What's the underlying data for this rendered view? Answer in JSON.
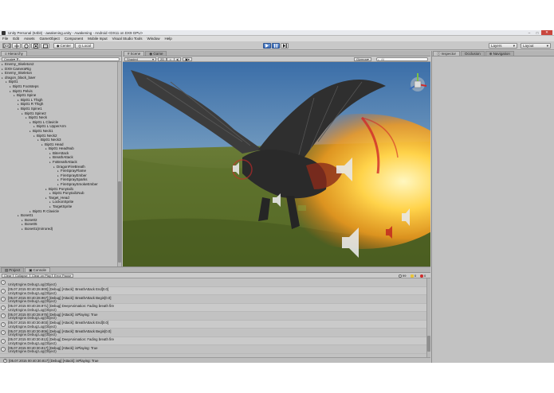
{
  "window": {
    "title": "Unity Personal (64bit) - awakening.unity - Awakening - Android <DX11 on DX9 GPU>",
    "controls": [
      "–",
      "□",
      "✕"
    ]
  },
  "menu": [
    "File",
    "Edit",
    "Assets",
    "GameObject",
    "Component",
    "Mobile Input",
    "Visual Studio Tools",
    "Window",
    "Help"
  ],
  "toolbar": {
    "center_label": "Center",
    "local_label": "Local",
    "layers_label": "Layers",
    "layout_label": "Layout"
  },
  "hierarchy": {
    "tab": "Hierarchy",
    "create_label": "Create",
    "items": [
      {
        "label": "Enemy_Skeleton2",
        "depth": 0
      },
      {
        "label": "DX9 CameraRig",
        "depth": 0
      },
      {
        "label": "Enemy_Skeleton",
        "depth": 0
      },
      {
        "label": "dragon_black_baer",
        "depth": 0
      },
      {
        "label": "Bip01",
        "depth": 1
      },
      {
        "label": "Bip01 Footsteps",
        "depth": 2
      },
      {
        "label": "Bip01 Pelvis",
        "depth": 2
      },
      {
        "label": "Bip01 Spine",
        "depth": 3
      },
      {
        "label": "Bip01 L Thigh",
        "depth": 4
      },
      {
        "label": "Bip01 R Thigh",
        "depth": 4
      },
      {
        "label": "Bip01 Spine1",
        "depth": 4
      },
      {
        "label": "Bip01 Spine2",
        "depth": 5
      },
      {
        "label": "Bip01 Neck",
        "depth": 6
      },
      {
        "label": "Bip01 L Clavicle",
        "depth": 7
      },
      {
        "label": "Bip01 L UpperArm",
        "depth": 8
      },
      {
        "label": "Bip01 Neck1",
        "depth": 7
      },
      {
        "label": "Bip01 Neck2",
        "depth": 8
      },
      {
        "label": "Bip01 Neck3",
        "depth": 9
      },
      {
        "label": "Bip01 Head",
        "depth": 10
      },
      {
        "label": "Bip01 HeadNub",
        "depth": 11
      },
      {
        "label": "BiteAttack",
        "depth": 12
      },
      {
        "label": "BreathAttack",
        "depth": 12
      },
      {
        "label": "FxBreathAttack",
        "depth": 12
      },
      {
        "label": "DragonFireBreath",
        "depth": 13
      },
      {
        "label": "FireSprayFlame",
        "depth": 14
      },
      {
        "label": "FireSprayEmber",
        "depth": 14
      },
      {
        "label": "FireSpraySparks",
        "depth": 14
      },
      {
        "label": "FireSpraySmokeEmber",
        "depth": 14
      },
      {
        "label": "Bip01 Ponytail1",
        "depth": 11
      },
      {
        "label": "Bip01 Ponytail1Nub",
        "depth": 12
      },
      {
        "label": "Target_Head",
        "depth": 11
      },
      {
        "label": "LockonSprite",
        "depth": 12
      },
      {
        "label": "TargetSprite",
        "depth": 12
      },
      {
        "label": "Bip01 R Clavicle",
        "depth": 7
      },
      {
        "label": "Bone01",
        "depth": 4
      },
      {
        "label": "Bone02",
        "depth": 5
      },
      {
        "label": "Bone05",
        "depth": 5
      },
      {
        "label": "Bone01(mirrored)",
        "depth": 5
      }
    ]
  },
  "scene": {
    "tab_scene": "Scene",
    "tab_game": "Game",
    "shading": "Shaded",
    "mode_2d": "2D",
    "gizmos": "Gizmos",
    "search_placeholder": "All"
  },
  "inspector": {
    "tab_inspector": "Inspector",
    "tab_occlusion": "Occlusion",
    "tab_navigation": "Navigation"
  },
  "bottom_tabs": {
    "project": "Project",
    "console": "Console"
  },
  "console": {
    "buttons": [
      "Clear",
      "Collapse",
      "Clear on Play",
      "Error Pause"
    ],
    "counts": {
      "info": "99",
      "warn": "0",
      "error": "0"
    },
    "logs": [
      {
        "line1": "",
        "line2": "UnityEngine.Debug:Log(Object)"
      },
      {
        "line1": "[05.07.2015 00:40:28.900] [Debug] [Attack]: BreathAttack End[0.0]",
        "line2": "UnityEngine.Debug:Log(Object)"
      },
      {
        "line1": "[05.07.2015 00:40:28.967] [Debug] [Attack]: BreathAttack Begin[0.0]",
        "line2": "UnityEngine.Debug:Log(Object)"
      },
      {
        "line1": "[05.07.2015 00:40:28.971] [Debug] DeepAnimation: Fading breath fire",
        "line2": "UnityEngine.Debug:Log(Object)"
      },
      {
        "line1": "[05.07.2015 00:40:28.975] [Debug] [Attack]: isPlaying: True",
        "line2": "UnityEngine.Debug:Log(Object)"
      },
      {
        "line1": "[05.07.2015 00:40:30.803] [Debug] [Attack]: BreathAttack End[0.0]",
        "line2": "UnityEngine.Debug:Log(Object)"
      },
      {
        "line1": "[05.07.2015 00:40:30.806] [Debug] [Attack]: BreathAttack Begin[0.0]",
        "line2": "UnityEngine.Debug:Log(Object)"
      },
      {
        "line1": "[05.07.2015 00:40:30.812] [Debug] DeepAnimation: Fading breath fire",
        "line2": "UnityEngine.Debug:Log(Object)"
      },
      {
        "line1": "[05.07.2015 00:40:30.817] [Debug] [Attack]: isPlaying: True",
        "line2": "UnityEngine.Debug:Log(Object)"
      }
    ]
  },
  "status": {
    "text": "[05.07.2015 00:40:30.817] [Debug] [Attack]: isPlaying: True"
  },
  "colors": {
    "editor_bg": "#c2c2c2",
    "play_blue": "#3b6dbb",
    "fire": "#f5a623",
    "gizmo_red": "#d02a2a"
  },
  "icons": [
    "hand-icon",
    "move-icon",
    "rotate-icon",
    "scale-icon",
    "rect-icon",
    "play-icon",
    "pause-icon",
    "step-icon",
    "speaker-icon",
    "scene-gizmo-icon",
    "info-icon"
  ]
}
